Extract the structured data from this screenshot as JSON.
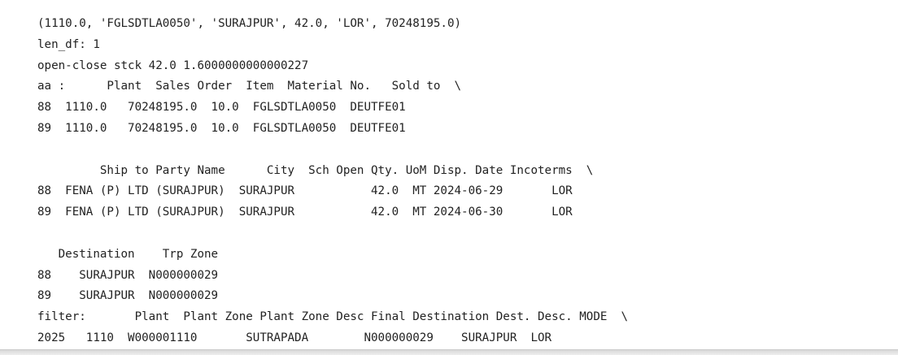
{
  "output": {
    "lines": [
      "(1110.0, 'FGLSDTLA0050', 'SURAJPUR', 42.0, 'LOR', 70248195.0)",
      "len_df: 1",
      "open-close stck 42.0 1.6000000000000227",
      "aa :      Plant  Sales Order  Item  Material No.   Sold to  \\",
      "88  1110.0   70248195.0  10.0  FGLSDTLA0050  DEUTFE01",
      "89  1110.0   70248195.0  10.0  FGLSDTLA0050  DEUTFE01",
      "",
      "         Ship to Party Name      City  Sch Open Qty. UoM Disp. Date Incoterms  \\",
      "88  FENA (P) LTD (SURAJPUR)  SURAJPUR           42.0  MT 2024-06-29       LOR",
      "89  FENA (P) LTD (SURAJPUR)  SURAJPUR           42.0  MT 2024-06-30       LOR",
      "",
      "   Destination    Trp Zone",
      "88    SURAJPUR  N000000029",
      "89    SURAJPUR  N000000029",
      "filter:       Plant  Plant Zone Plant Zone Desc Final Destination Dest. Desc. MODE  \\",
      "2025   1110  W000001110       SUTRAPADA        N000000029    SURAJPUR  LOR"
    ]
  }
}
